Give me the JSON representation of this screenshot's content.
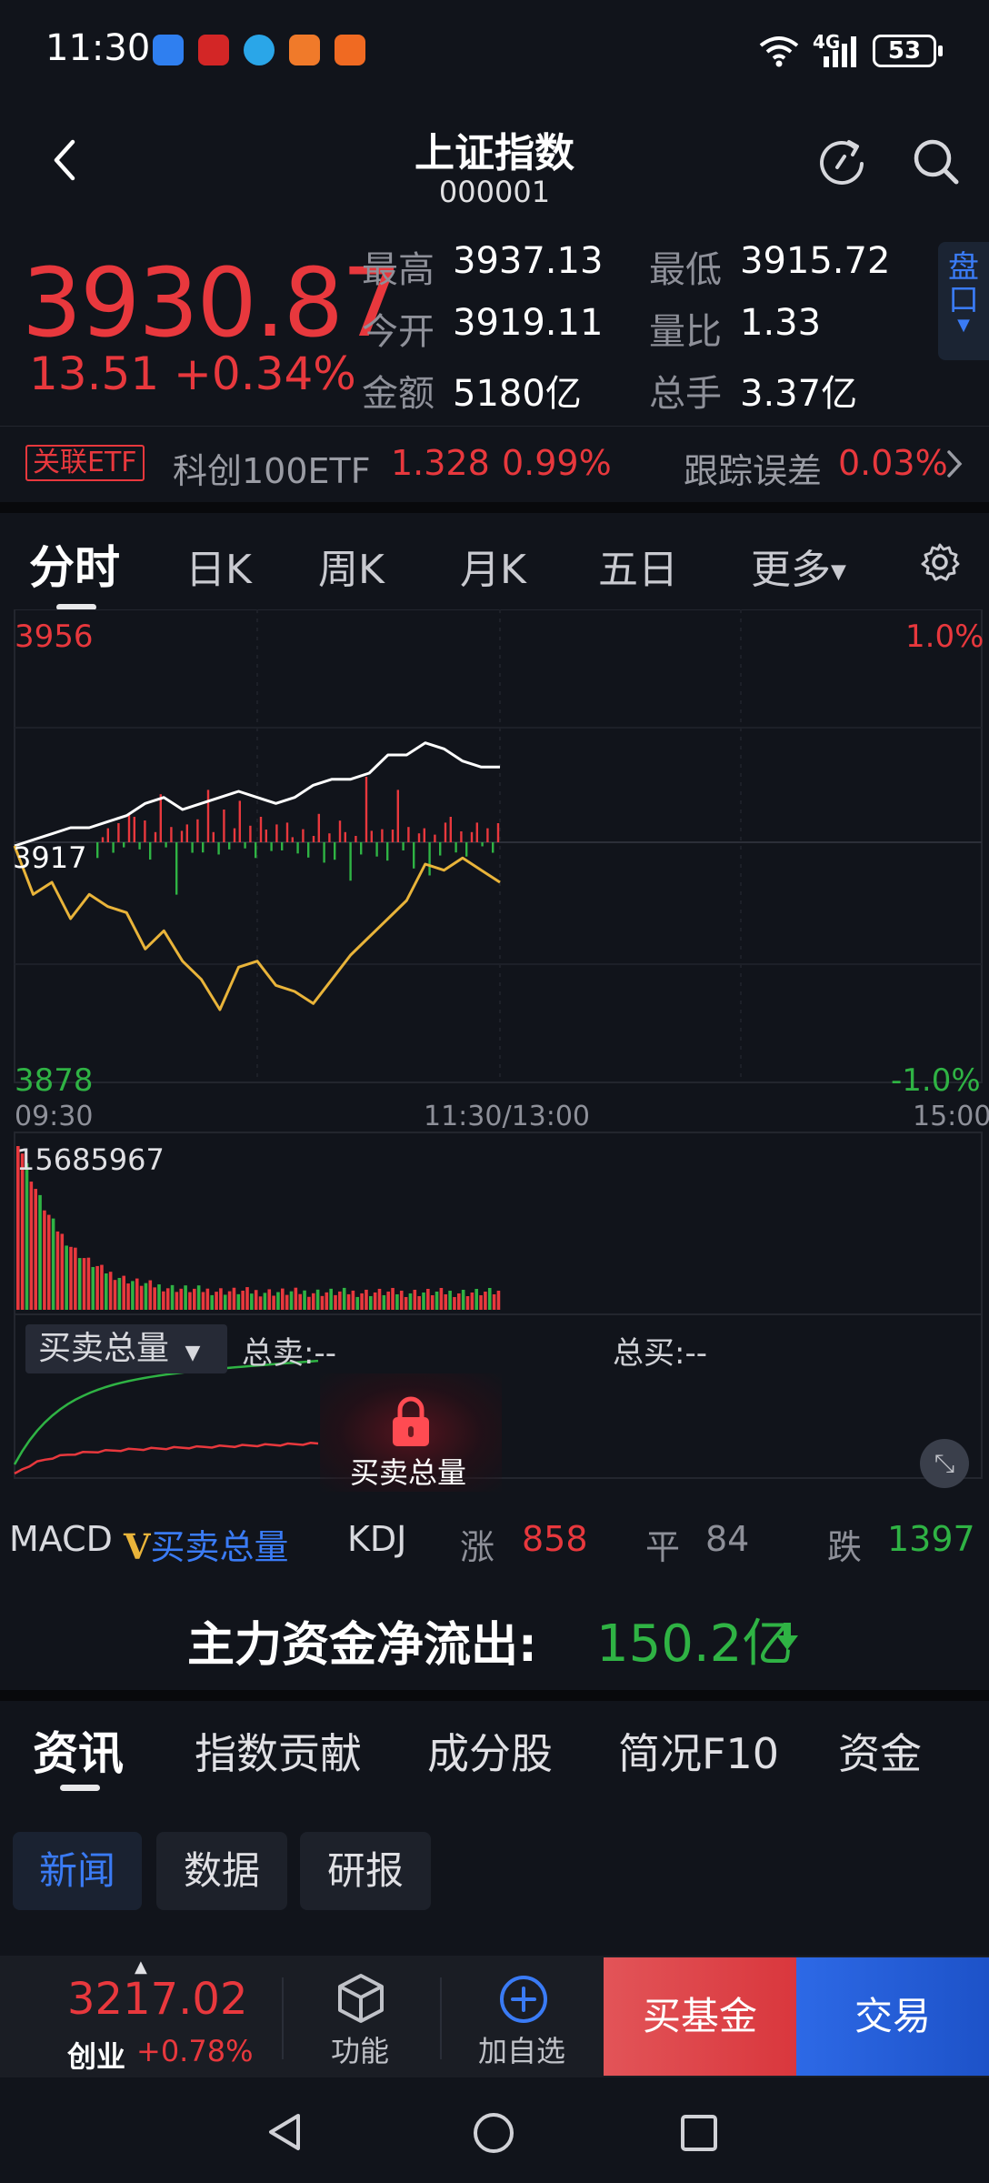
{
  "status_bar": {
    "time": "11:30",
    "network": "4G",
    "battery": "53",
    "notification_icons": [
      "calendar-icon",
      "xuexi-icon",
      "browser-icon",
      "app-orange-icon",
      "app-orange-icon-2"
    ]
  },
  "header": {
    "title": "上证指数",
    "code": "000001"
  },
  "quote": {
    "price": "3930.87",
    "change": "13.51 +0.34%",
    "stats": [
      {
        "label": "最高",
        "value": "3937.13"
      },
      {
        "label": "最低",
        "value": "3915.72"
      },
      {
        "label": "今开",
        "value": "3919.11"
      },
      {
        "label": "量比",
        "value": "1.33"
      },
      {
        "label": "金额",
        "value": "5180亿"
      },
      {
        "label": "总手",
        "value": "3.37亿"
      }
    ],
    "pankou_label": "盘口"
  },
  "etf": {
    "tag": "关联ETF",
    "name": "科创100ETF",
    "price": "1.328",
    "pct": "0.99%",
    "tracking_label": "跟踪误差",
    "tracking_value": "0.03%"
  },
  "kline_tabs": [
    "分时",
    "日K",
    "周K",
    "月K",
    "五日",
    "更多"
  ],
  "chart": {
    "price_axis_top": "3956",
    "price_axis_mid": "3917",
    "price_axis_bottom": "3878",
    "pct_axis_top": "1.0%",
    "pct_axis_bottom": "-1.0%",
    "time_start": "09:30",
    "time_mid": "11:30/13:00",
    "time_end": "15:00",
    "volume_max": "15685967"
  },
  "chart_data": {
    "type": "line",
    "x_range": [
      "09:30",
      "15:00"
    ],
    "ylim": [
      3878,
      3956
    ],
    "y_right": [
      "-1.0%",
      "1.0%"
    ],
    "series": [
      {
        "values": [
          3917,
          3918,
          3919,
          3920,
          3920,
          3921,
          3922,
          3924,
          3925,
          3923,
          3924,
          3925,
          3926,
          3925,
          3924,
          3925,
          3927,
          3928,
          3928,
          3929,
          3932,
          3932,
          3934,
          3933,
          3931,
          3930,
          3930
        ]
      },
      {
        "values": [
          3917,
          3909,
          3911,
          3905,
          3909,
          3907,
          3906,
          3900,
          3903,
          3898,
          3895,
          3890,
          3897,
          3898,
          3894,
          3893,
          3891,
          3895,
          3899,
          3902,
          3905,
          3908,
          3914,
          3913,
          3915,
          3913,
          3911
        ]
      }
    ],
    "volume": {
      "max": 15685967
    },
    "colors": {
      "price_line": "#ffffff",
      "avg_line": "#e9b43a",
      "up": "#e8383d",
      "down": "#2fb344"
    }
  },
  "indicator": {
    "selected": "买卖总量",
    "total_sell": "总卖:--",
    "total_buy": "总买:--",
    "lock_label": "买卖总量"
  },
  "indicator_tabs": [
    {
      "label": "MACD"
    },
    {
      "label": "买卖总量"
    },
    {
      "label": "KDJ"
    }
  ],
  "breadth": {
    "up_label": "涨",
    "up_count": "858",
    "flat_label": "平",
    "flat_count": "84",
    "down_label": "跌",
    "down_count": "1397"
  },
  "flow": {
    "label": "主力资金净流出:",
    "value": "150.2亿"
  },
  "info_tabs": [
    "资讯",
    "指数贡献",
    "成分股",
    "简况F10",
    "资金"
  ],
  "news_chips": [
    "新闻",
    "数据",
    "研报"
  ],
  "toolbar": {
    "ticker_price": "3217.02",
    "ticker_name": "创业",
    "ticker_pct": "+0.78%",
    "function_label": "功能",
    "watchlist_label": "加自选",
    "fund_label": "买基金",
    "trade_label": "交易"
  }
}
